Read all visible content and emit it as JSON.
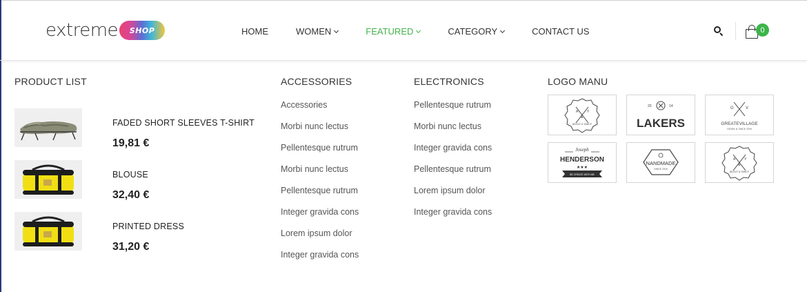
{
  "header": {
    "logo": {
      "word": "extreme",
      "badge": "SHOP"
    },
    "nav": [
      {
        "label": "HOME",
        "has_dropdown": false,
        "active": false
      },
      {
        "label": "WOMEN",
        "has_dropdown": true,
        "active": false
      },
      {
        "label": "FEATURED",
        "has_dropdown": true,
        "active": true
      },
      {
        "label": "CATEGORY",
        "has_dropdown": true,
        "active": false
      },
      {
        "label": "CONTACT US",
        "has_dropdown": false,
        "active": false
      }
    ],
    "cart_count": "0"
  },
  "colors": {
    "accent": "#44b349",
    "badge": "#3cb54a",
    "text": "#333333"
  },
  "icons": {
    "search": "search-icon",
    "cart": "shopping-bag-icon"
  },
  "mega_menu": {
    "product_list": {
      "title": "PRODUCT LIST",
      "items": [
        {
          "name": "FADED SHORT SLEEVES T-SHIRT",
          "price": "19,81 €",
          "image": "camping cot"
        },
        {
          "name": "BLOUSE",
          "price": "32,40 €",
          "image": "yellow duffel bag"
        },
        {
          "name": "PRINTED DRESS",
          "price": "31,20 €",
          "image": "yellow duffel bag"
        }
      ]
    },
    "accessories": {
      "title": "ACCESSORIES",
      "links": [
        "Accessories",
        "Morbi nunc lectus",
        "Pellentesque rutrum",
        "Morbi nunc lectus",
        "Pellentesque rutrum",
        "Integer gravida cons",
        "Lorem ipsum dolor",
        "Integer gravida cons"
      ]
    },
    "electronics": {
      "title": "ELECTRONICS",
      "links": [
        "Pellentesque rutrum",
        "Morbi nunc lectus",
        "Integer gravida cons",
        "Pellentesque rutrum",
        "Lorem ipsum dolor",
        "Integer gravida cons"
      ]
    },
    "logo_menu": {
      "title": "LOGO MANU",
      "brands": [
        {
          "top": "A",
          "mid": "&",
          "right": "Y",
          "bottom": "ADOLF & YANCY"
        },
        {
          "text": "LAKERS",
          "top_left": "20",
          "top_right": "14"
        },
        {
          "left": "G",
          "right": "V",
          "text": "GREATEVILLAGE",
          "sub": "DENIM ★ SINCE 2009"
        },
        {
          "script": "Joseph",
          "text": "HENDERSON",
          "stars": "★★★",
          "ribbon": "BE CREATE WITH ME"
        },
        {
          "text": "NANDMADE",
          "sub": "SINCE 2016"
        },
        {
          "top": "A",
          "mid": "&",
          "right": "Y",
          "bottom": "ADOLF & YANCY"
        }
      ]
    }
  }
}
